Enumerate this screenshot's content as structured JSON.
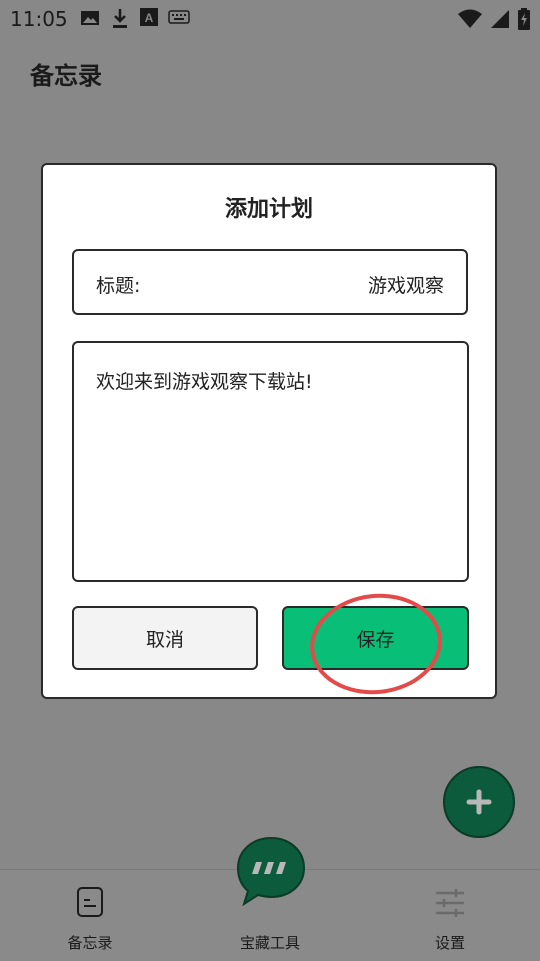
{
  "status_bar": {
    "time": "11:05",
    "icons": [
      "image-icon",
      "download-icon",
      "font-icon",
      "keyboard-icon"
    ],
    "right_icons": [
      "wifi-icon",
      "signal-icon",
      "battery-charging-icon"
    ]
  },
  "app": {
    "title": "备忘录"
  },
  "dialog": {
    "title": "添加计划",
    "title_field": {
      "label": "标题:",
      "value": "游戏观察"
    },
    "content_field": {
      "value": "欢迎来到游戏观察下载站!"
    },
    "cancel_label": "取消",
    "save_label": "保存"
  },
  "fab": {
    "icon": "plus-icon"
  },
  "bottom_nav": [
    {
      "label": "备忘录",
      "icon": "memo-icon"
    },
    {
      "label": "宝藏工具",
      "icon": "chat-bubble-icon"
    },
    {
      "label": "设置",
      "icon": "sliders-icon"
    }
  ],
  "colors": {
    "accent_green": "#09bf78",
    "fab_green": "#0c5b3c",
    "highlight_red": "#e34a4a",
    "scrim": "#888888"
  }
}
